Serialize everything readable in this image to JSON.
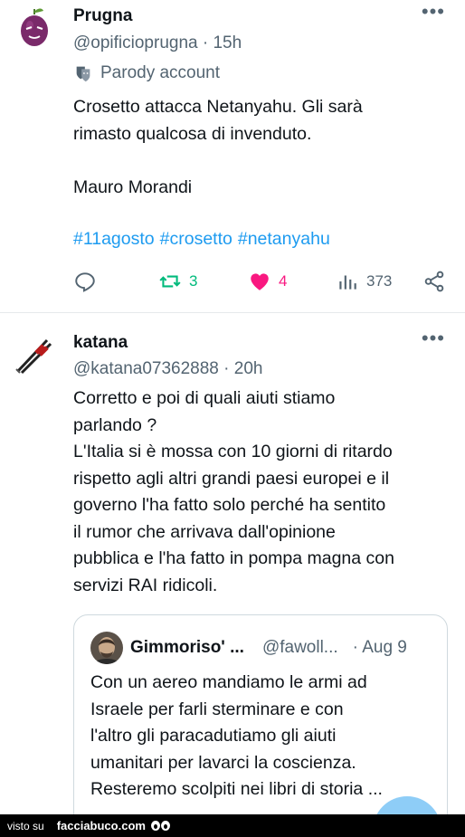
{
  "tweet1": {
    "name": "Prugna",
    "handle_time": "@opificioprugna · 15h",
    "parody_label": "Parody account",
    "text": "Crosetto attacca Netanyahu. Gli sarà\nrimasto qualcosa di invenduto.\n\nMauro Morandi",
    "hashtags": [
      "#11agosto",
      "#crosetto",
      "#netanyahu"
    ],
    "retweets": "3",
    "likes": "4",
    "views": "373"
  },
  "tweet2": {
    "name": "katana",
    "handle_time": "@katana07362888 · 20h",
    "text": "Corretto e poi di quali aiuti stiamo\nparlando ?\nL'Italia si è mossa con 10 giorni di ritardo\nrispetto agli altri grandi paesi europei e il\ngoverno l'ha fatto solo perché ha sentito\nil rumor che arrivava dall'opinione\npubblica e l'ha fatto in pompa magna con\nservizi RAI ridicoli.",
    "quote": {
      "name": "Gimmoriso' ...",
      "handle": "@fawoll...",
      "date": "· Aug 9",
      "text": "Con un aereo mandiamo le armi ad\nIsraele per farli sterminare e con\nl'altro gli paracadutiamo gli aiuti\numanitari per lavarci la coscienza.\nResteremo scolpiti nei libri di storia ..."
    }
  },
  "footer": {
    "prefix": "visto su",
    "brand": "facciabuco.com"
  },
  "colors": {
    "accent": "#1d9bf0",
    "retweet": "#00ba7c",
    "like": "#f91880",
    "muted": "#536471"
  },
  "icons": [
    "plum-avatar-icon",
    "more-icon",
    "parody-mask-icon",
    "reply-icon",
    "retweet-icon",
    "heart-icon",
    "views-icon",
    "share-icon",
    "katana-avatar-icon"
  ]
}
